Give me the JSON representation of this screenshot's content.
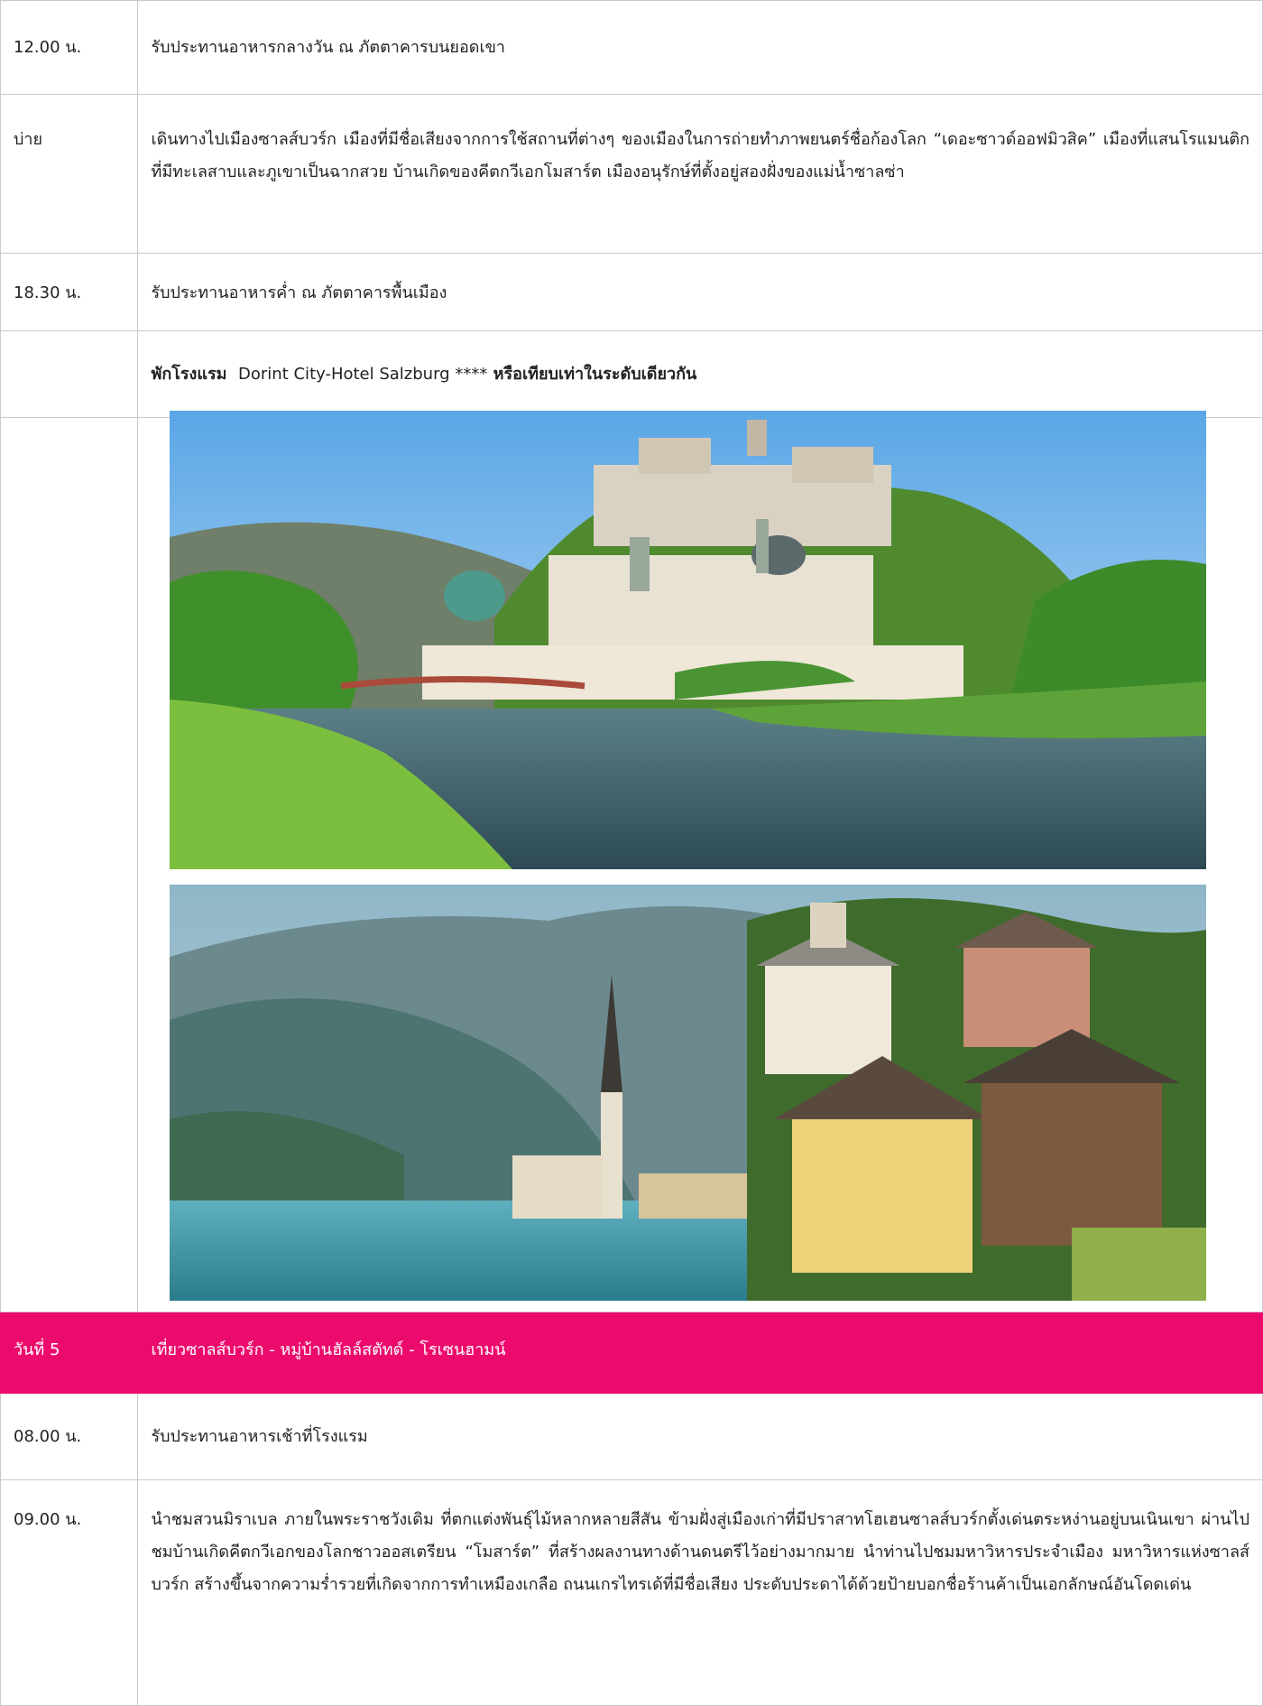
{
  "rows": [
    {
      "time": "12.00 น.",
      "text": "รับประทานอาหารกลางวัน ณ ภัตตาคารบนยอดเขา"
    },
    {
      "time": "บ่าย",
      "text": "เดินทางไปเมืองซาลส์บวร์ก เมืองที่มีชื่อเสียงจากการใช้สถานที่ต่างๆ ของเมืองในการถ่ายทำภาพยนตร์ชื่อก้องโลก “เดอะซาวด์ออฟมิวสิค” เมืองที่แสนโรแมนติกที่มีทะเลสาบและภูเขาเป็นฉากสวย บ้านเกิดของคีตกวีเอกโมสาร์ต เมืองอนุรักษ์ที่ตั้งอยู่สองฝั่งของแม่น้ำซาลซ่า"
    },
    {
      "time": "18.30 น.",
      "text": "รับประทานอาหารค่ำ ณ ภัตตาคารพื้นเมือง"
    }
  ],
  "hotel": {
    "prefix": "พักโรงแรม",
    "name": "Dorint City-Hotel Salzburg ****",
    "suffix": "หรือเทียบเท่าในระดับเดียวกัน"
  },
  "day": {
    "label": "วันที่ 5",
    "title": "เที่ยวซาลส์บวร์ก - หมู่บ้านฮัลล์สตัทด์ - โรเซนฮามน์"
  },
  "day_rows": [
    {
      "time": "08.00 น.",
      "text": "รับประทานอาหารเช้าที่โรงแรม"
    },
    {
      "time": "09.00 น.",
      "text": "นำชมสวนมิราเบล ภายในพระราชวังเดิม ที่ตกแต่งพันธุ์ไม้หลากหลายสีสัน ข้ามฝั่งสู่เมืองเก่าที่มีปราสาทโฮเฮนซาลส์บวร์กตั้งเด่นตระหง่านอยู่บนเนินเขา ผ่านไปชมบ้านเกิดคีตกวีเอกของโลกชาวออสเตรียน “โมสาร์ต” ที่สร้างผลงานทางด้านดนตรีไว้อย่างมากมาย นำท่านไปชมมหาวิหารประจำเมือง มหาวิหารแห่งซาลส์บวร์ก สร้างขึ้นจากความร่ำรวยที่เกิดจากการทำเหมืองเกลือ ถนนเกรไทรเด้ที่มีชื่อเสียง ประดับประดาได้ด้วยป้ายบอกชื่อร้านค้าเป็นเอกลักษณ์อันโดดเด่น"
    }
  ],
  "colors": {
    "day_band": "#ec0b6d",
    "border": "#c9c9c9"
  }
}
